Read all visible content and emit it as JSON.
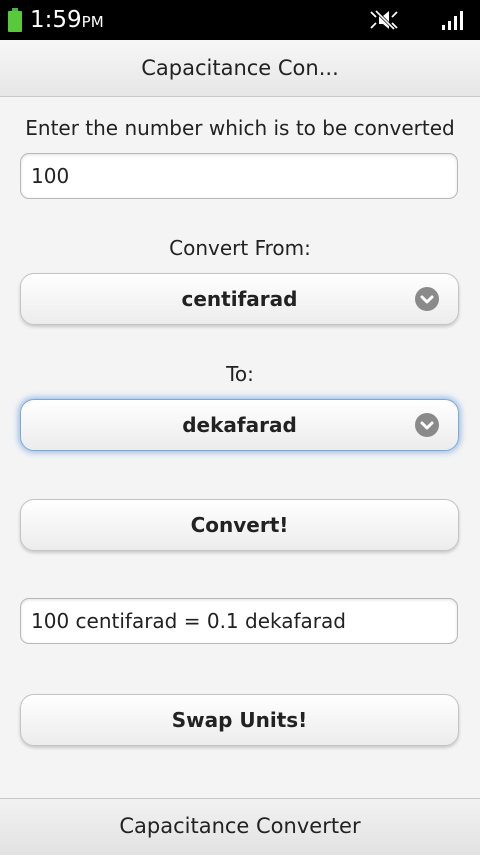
{
  "status_bar": {
    "time": "1:59",
    "ampm": "PM"
  },
  "header": {
    "title": "Capacitance Con..."
  },
  "form": {
    "input_label": "Enter the number which is to be converted",
    "input_value": "100",
    "from_label": "Convert From:",
    "from_value": "centifarad",
    "to_label": "To:",
    "to_value": "dekafarad",
    "convert_label": "Convert!",
    "result_value": "100 centifarad = 0.1 dekafarad",
    "swap_label": "Swap Units!"
  },
  "footer": {
    "title": "Capacitance Converter"
  },
  "icons": {
    "battery": "battery-icon",
    "silent": "silent-mode-icon",
    "signal": "signal-strength-icon",
    "chevron": "chevron-down-icon"
  },
  "colors": {
    "battery": "#58c93a",
    "focus_glow": "#5a96dc"
  }
}
